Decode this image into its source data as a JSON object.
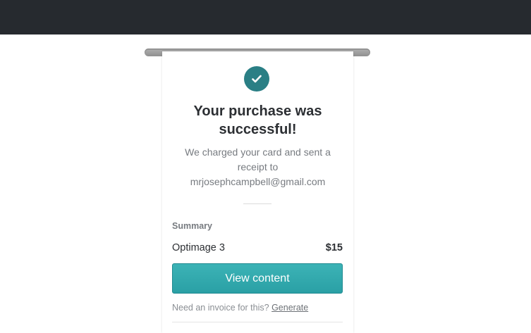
{
  "header": {
    "background": "#262a2f"
  },
  "receipt": {
    "status_icon": "checkmark-icon",
    "title": "Your purchase was successful!",
    "message_line1": "We charged your card and sent a",
    "message_line2": "receipt to",
    "email": "mrjosephcampbell@gmail.com",
    "summary_label": "Summary",
    "item": {
      "name": "Optimage 3",
      "price": "$15"
    },
    "view_button_label": "View content",
    "invoice_prompt": "Need an invoice for this?",
    "invoice_link": "Generate"
  },
  "colors": {
    "accent": "#2aa0a5",
    "badge": "#2a7f85",
    "text_dark": "#2c2f33",
    "text_muted": "#777b80"
  }
}
